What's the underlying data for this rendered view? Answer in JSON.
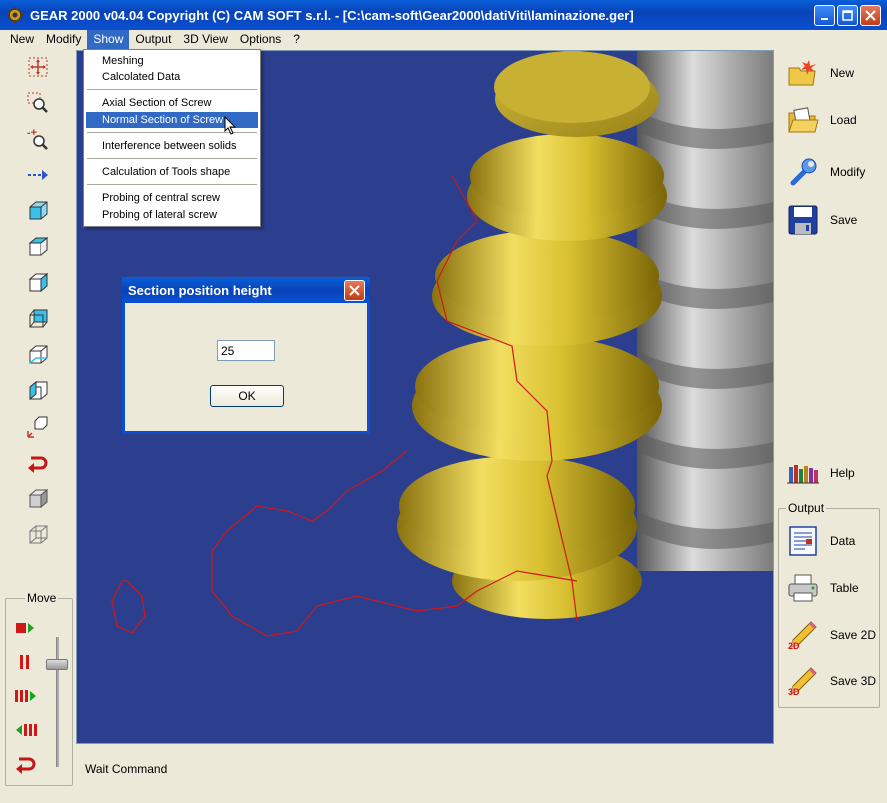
{
  "window": {
    "title": "GEAR 2000 v04.04     Copyright (C)  CAM SOFT s.r.l. - [C:\\cam-soft\\Gear2000\\datiViti\\laminazione.ger]"
  },
  "menu": {
    "items": [
      "New",
      "Modify",
      "Show",
      "Output",
      "3D View",
      "Options",
      "?"
    ],
    "active": "Show"
  },
  "show_menu": {
    "items": [
      "Meshing",
      "Calcolated Data",
      "Axial Section of Screw",
      "Normal Section of Screw",
      "Interference between solids",
      "Calculation of Tools shape",
      "Probing of central screw",
      "Probing of lateral screw"
    ],
    "highlighted": "Normal Section of Screw"
  },
  "dialog": {
    "title": "Section position height",
    "value": "25",
    "ok_label": "OK"
  },
  "left_panel": {
    "move_label": "Move"
  },
  "right_panel": {
    "new_label": "New",
    "load_label": "Load",
    "modify_label": "Modify",
    "save_label": "Save",
    "help_label": "Help",
    "output_label": "Output",
    "data_label": "Data",
    "table_label": "Table",
    "save2d_label": "Save 2D",
    "save3d_label": "Save 3D"
  },
  "status": {
    "text": "Wait Command"
  },
  "colors": {
    "viewport_bg": "#2c3e8e",
    "gold": "#d8c030",
    "silver": "#b8b8b8",
    "section_line": "#d01818",
    "highlight": "#316ac5"
  }
}
